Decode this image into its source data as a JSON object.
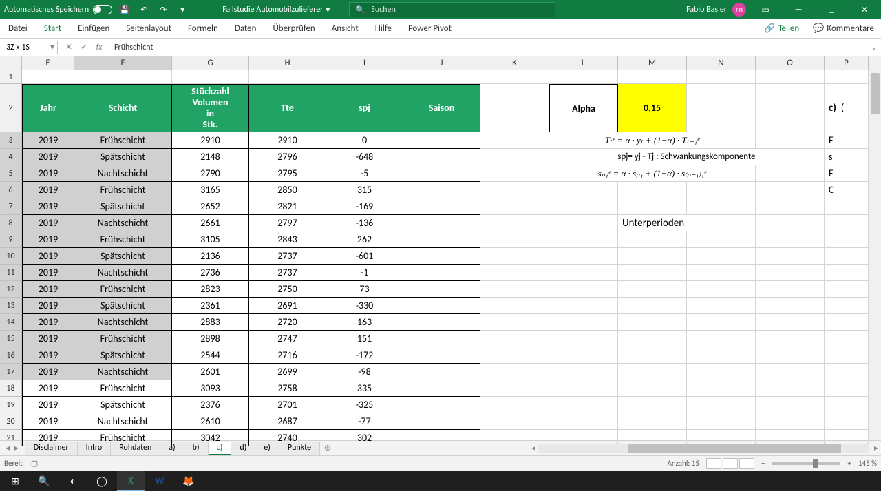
{
  "titlebar": {
    "autosave": "Automatisches Speichern",
    "doc": "Fallstudie Automobilzulieferer",
    "search_placeholder": "Suchen",
    "user": "Fabio Basler",
    "user_initials": "FB"
  },
  "ribbon": {
    "tabs": [
      "Datei",
      "Start",
      "Einfügen",
      "Seitenlayout",
      "Formeln",
      "Daten",
      "Überprüfen",
      "Ansicht",
      "Hilfe",
      "Power Pivot"
    ],
    "share": "Teilen",
    "comments": "Kommentare"
  },
  "fbar": {
    "ref": "3Z x 1S",
    "value": "Frühschicht"
  },
  "columns": [
    "E",
    "F",
    "G",
    "H",
    "I",
    "J",
    "K",
    "L",
    "M",
    "N",
    "O",
    "P"
  ],
  "rowheaders": [
    1,
    2,
    3,
    4,
    5,
    6,
    7,
    8,
    9,
    10,
    11,
    12,
    13,
    14,
    15,
    16,
    17,
    18,
    19,
    20,
    21
  ],
  "headers": {
    "jahr": "Jahr",
    "schicht": "Schicht",
    "stueck": "Stückzahl Volumen in Stk.",
    "tte": "Tte",
    "spj": "spj",
    "saison": "Saison"
  },
  "alpha": {
    "label": "Alpha",
    "value": "0,15"
  },
  "formulas": {
    "f1": "Tₜᵉ = α · yₜ + (1−α) · Tₜ₋₁ᵉ",
    "f2": "spj= yj - Tj : Schwankungskomponente",
    "f3": "sₚ₁ᵉ = α · sₚ₁ + (1−α) · s₍ₚ₋₁₎₁ᵉ",
    "unter": "Unterperioden"
  },
  "c_label": "c)",
  "rows": [
    {
      "jahr": "2019",
      "schicht": "Frühschicht",
      "g": "2910",
      "h": "2910",
      "i": "0"
    },
    {
      "jahr": "2019",
      "schicht": "Spätschicht",
      "g": "2148",
      "h": "2796",
      "i": "-648"
    },
    {
      "jahr": "2019",
      "schicht": "Nachtschicht",
      "g": "2790",
      "h": "2795",
      "i": "-5"
    },
    {
      "jahr": "2019",
      "schicht": "Frühschicht",
      "g": "3165",
      "h": "2850",
      "i": "315"
    },
    {
      "jahr": "2019",
      "schicht": "Spätschicht",
      "g": "2652",
      "h": "2821",
      "i": "-169"
    },
    {
      "jahr": "2019",
      "schicht": "Nachtschicht",
      "g": "2661",
      "h": "2797",
      "i": "-136"
    },
    {
      "jahr": "2019",
      "schicht": "Frühschicht",
      "g": "3105",
      "h": "2843",
      "i": "262"
    },
    {
      "jahr": "2019",
      "schicht": "Spätschicht",
      "g": "2136",
      "h": "2737",
      "i": "-601"
    },
    {
      "jahr": "2019",
      "schicht": "Nachtschicht",
      "g": "2736",
      "h": "2737",
      "i": "-1"
    },
    {
      "jahr": "2019",
      "schicht": "Frühschicht",
      "g": "2823",
      "h": "2750",
      "i": "73"
    },
    {
      "jahr": "2019",
      "schicht": "Spätschicht",
      "g": "2361",
      "h": "2691",
      "i": "-330"
    },
    {
      "jahr": "2019",
      "schicht": "Nachtschicht",
      "g": "2883",
      "h": "2720",
      "i": "163"
    },
    {
      "jahr": "2019",
      "schicht": "Frühschicht",
      "g": "2898",
      "h": "2747",
      "i": "151"
    },
    {
      "jahr": "2019",
      "schicht": "Spätschicht",
      "g": "2544",
      "h": "2716",
      "i": "-172"
    },
    {
      "jahr": "2019",
      "schicht": "Nachtschicht",
      "g": "2601",
      "h": "2699",
      "i": "-98"
    },
    {
      "jahr": "2019",
      "schicht": "Frühschicht",
      "g": "3093",
      "h": "2758",
      "i": "335"
    },
    {
      "jahr": "2019",
      "schicht": "Spätschicht",
      "g": "2376",
      "h": "2701",
      "i": "-325"
    },
    {
      "jahr": "2019",
      "schicht": "Nachtschicht",
      "g": "2610",
      "h": "2687",
      "i": "-77"
    },
    {
      "jahr": "2019",
      "schicht": "Frühschicht",
      "g": "3042",
      "h": "2740",
      "i": "302"
    }
  ],
  "sheets": [
    "Disclaimer",
    "Intro",
    "Rohdaten",
    "a)",
    "b)",
    "c)",
    "d)",
    "e)",
    "Punkte"
  ],
  "active_sheet": "c)",
  "status": {
    "ready": "Bereit",
    "count": "Anzahl: 15",
    "zoom": "145 %"
  },
  "selected_rows": [
    3,
    4,
    5,
    6,
    7,
    8,
    9,
    10,
    11,
    12,
    13,
    14,
    15,
    16,
    17
  ]
}
